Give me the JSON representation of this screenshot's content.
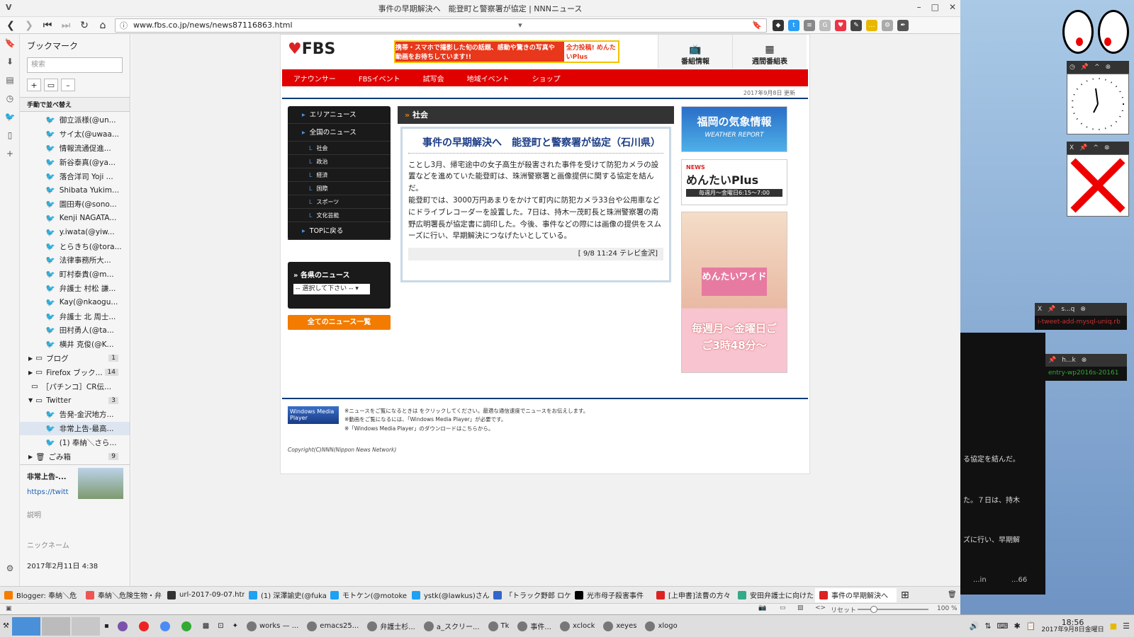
{
  "window": {
    "app_letter": "V",
    "title": "事件の早期解決へ　能登町と警察署が協定 | NNNニュース",
    "url": "www.fbs.co.jp/news/news87116863.html",
    "url_icon": "info-circle"
  },
  "sidebar": {
    "title": "ブックマーク",
    "search_placeholder": "検索",
    "sort_label": "手動で並べ替え",
    "items": [
      {
        "label": "御立派様(@un...",
        "type": "twitter"
      },
      {
        "label": "サイ太(@uwaa...",
        "type": "twitter"
      },
      {
        "label": "情報流通促進...",
        "type": "twitter"
      },
      {
        "label": "新谷泰真(@ya...",
        "type": "twitter"
      },
      {
        "label": "落合洋司 Yoji ...",
        "type": "twitter"
      },
      {
        "label": "Shibata Yukim...",
        "type": "twitter"
      },
      {
        "label": "園田寿(@sono...",
        "type": "twitter"
      },
      {
        "label": "Kenji NAGATA...",
        "type": "twitter"
      },
      {
        "label": "y.iwata(@yiw...",
        "type": "twitter"
      },
      {
        "label": "とらきち(@tora...",
        "type": "twitter"
      },
      {
        "label": "法律事務所大...",
        "type": "twitter"
      },
      {
        "label": "町村泰貴(@m...",
        "type": "twitter"
      },
      {
        "label": "弁護士 村松 謙...",
        "type": "twitter"
      },
      {
        "label": "Kay(@nkaogu...",
        "type": "twitter"
      },
      {
        "label": "弁護士 北 周士...",
        "type": "twitter"
      },
      {
        "label": "田村勇人(@ta...",
        "type": "twitter"
      },
      {
        "label": "横井 克俊(@K...",
        "type": "twitter"
      }
    ],
    "folders": [
      {
        "label": "ブログ",
        "count": "1"
      },
      {
        "label": "Firefox ブック...",
        "count": "14"
      },
      {
        "label": "［パチンコ］CR伝..."
      },
      {
        "label": "Twitter",
        "count": "3"
      }
    ],
    "twitter_children": [
      "告発-金沢地方...",
      "非常上告-最高...",
      "(1) 奉納＼さら..."
    ],
    "trash": {
      "label": "ごみ箱",
      "count": "9"
    },
    "detail": {
      "title": "非常上告-...",
      "link": "https://twitt",
      "desc_label": "説明",
      "nick_label": "ニックネーム",
      "date": "2017年2月11日 4:38"
    }
  },
  "site": {
    "logo": "FBS",
    "banner_text": "携帯・スマホで撮影した旬の話題、感動や驚きの写真や動画をお待ちしています!!",
    "banner_badge": "全力投稿! めんたいPlus",
    "top_nav": [
      "番組情報",
      "週間番組表"
    ],
    "red_nav": [
      "アナウンサー",
      "FBSイベント",
      "試写会",
      "地域イベント",
      "ショップ"
    ],
    "updated": "2017年9月8日 更新",
    "left_menu": [
      {
        "label": "エリアニュース",
        "sub": false
      },
      {
        "label": "全国のニュース",
        "sub": false
      },
      {
        "label": "社会",
        "sub": true
      },
      {
        "label": "政治",
        "sub": true
      },
      {
        "label": "経済",
        "sub": true
      },
      {
        "label": "国際",
        "sub": true
      },
      {
        "label": "スポーツ",
        "sub": true
      },
      {
        "label": "文化芸能",
        "sub": true
      },
      {
        "label": "TOPに戻る",
        "sub": false
      }
    ],
    "pref_title": "各県のニュース",
    "pref_select": "-- 選択して下さい --",
    "all_news": "全てのニュース一覧",
    "article": {
      "category": "社会",
      "title": "事件の早期解決へ　能登町と警察署が協定（石川県）",
      "p1": "ことし3月、帰宅途中の女子高生が殺害された事件を受けて防犯カメラの設置などを進めていた能登町は、珠洲警察署と画像提供に関する協定を結んだ。",
      "p2": "能登町では、3000万円あまりをかけて町内に防犯カメラ33台や公用車などにドライブレコーダーを設置した。7日は、持木一茂町長と珠洲警察署の南野広明署長が協定書に調印した。今後、事件などの際には画像の提供をスムーズに行い、早期解決につなげたいとしている。",
      "source": "[ 9/8 11:24 テレビ金沢]"
    },
    "ads": {
      "weather_main": "福岡の気象情報",
      "weather_sub": "WEATHER REPORT",
      "mentai_news": "NEWS",
      "mentai_title": "めんたいPlus",
      "mentai_sub": "毎週月〜金曜日6:15〜7:00",
      "wide_title": "めんたいワイド",
      "wide_time": "毎週月〜金曜日ごご3時48分〜"
    },
    "wmp_label": "Windows Media Player",
    "footnotes": [
      "※ニュースをご覧になるときは をクリックしてください。最適な通信速度でニュースをお伝えします。",
      "※動画をご覧になるには、「Windows Media Player」が必要です。",
      "※「Windows Media Player」のダウンロードはこちらから。"
    ],
    "copyright": "Copyright(C)NNN(Nippon News Network)"
  },
  "tabs": [
    {
      "label": "Blogger: 奉納＼危",
      "color": "#f57d00"
    },
    {
      "label": "奉納＼危険生物・弁",
      "color": "#e55"
    },
    {
      "label": "url-2017-09-07.htm",
      "color": "#333"
    },
    {
      "label": "(1) 深澤諭史(@fuka",
      "color": "#1da1f2"
    },
    {
      "label": "モトケン(@motoken",
      "color": "#1da1f2"
    },
    {
      "label": "ystk(@lawkus)さん",
      "color": "#1da1f2"
    },
    {
      "label": "「トラック野郎 ロケ地",
      "color": "#36c"
    },
    {
      "label": "光市母子殺害事件",
      "color": "#000"
    },
    {
      "label": "[上申書]法曹の方々",
      "color": "#d22"
    },
    {
      "label": "安田弁護士に向けた",
      "color": "#3a8"
    },
    {
      "label": "事件の早期解決へ",
      "color": "#d22"
    }
  ],
  "status": {
    "reset": "リセット",
    "zoom": "100 %"
  },
  "desktop": {
    "term_text_1": "る協定を結んだ。",
    "term_text_2": "た。７日は、持木",
    "term_text_3": "ズに行い、早期解",
    "win1": "s...q",
    "win2": "h...k",
    "red1": "i-tweet-add-mysql-uniq.rb",
    "green1": "entry-wp2016s-20161",
    "ws1": "...in",
    "ws2": "...66"
  },
  "taskbar": {
    "items": [
      "works — ...",
      "emacs25...",
      "弁護士杉...",
      "a_スクリー...",
      "Tk",
      "事件...",
      "xclock",
      "xeyes",
      "xlogo"
    ],
    "clock_time": "18:56",
    "clock_date": "2017年9月8日金曜日"
  }
}
